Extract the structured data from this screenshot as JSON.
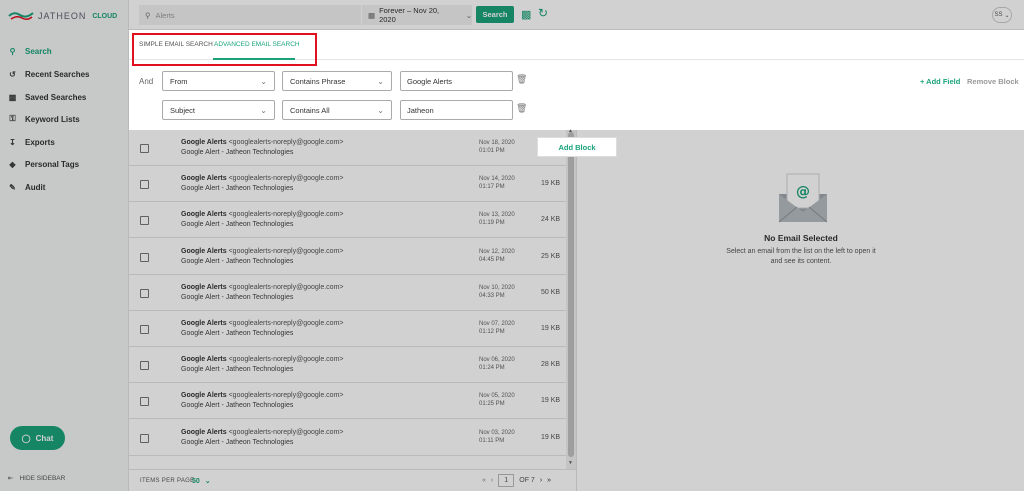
{
  "app": {
    "logo_text": "JATHEON",
    "logo_badge": "CLOUD"
  },
  "sidebar": {
    "items": [
      {
        "label": "Search",
        "icon": "search-icon"
      },
      {
        "label": "Recent Searches",
        "icon": "history-icon"
      },
      {
        "label": "Saved Searches",
        "icon": "save-icon"
      },
      {
        "label": "Keyword Lists",
        "icon": "key-icon"
      },
      {
        "label": "Exports",
        "icon": "export-icon"
      },
      {
        "label": "Personal Tags",
        "icon": "tag-icon"
      },
      {
        "label": "Audit",
        "icon": "audit-icon"
      }
    ],
    "chat_label": "Chat",
    "hide_label": "HIDE SIDEBAR"
  },
  "topbar": {
    "search_placeholder": "Alerts",
    "date_range": "Forever – Nov 20, 2020",
    "search_button": "Search",
    "user_initials": "SS"
  },
  "tabs": {
    "simple": "SIMPLE EMAIL SEARCH",
    "advanced": "ADVANCED EMAIL SEARCH",
    "active": "advanced"
  },
  "query": {
    "operator": "And",
    "rows": [
      {
        "field": "From",
        "condition": "Contains Phrase",
        "value": "Google Alerts"
      },
      {
        "field": "Subject",
        "condition": "Contains All",
        "value": "Jatheon"
      }
    ],
    "add_field": "+ Add Field",
    "remove_block": "Remove Block",
    "add_block": "Add Block"
  },
  "emails": [
    {
      "sender": "Google Alerts",
      "address": "<googlealerts-noreply@google.com>",
      "subject": "Google Alert - Jatheon Technologies",
      "date": "Nov 18, 2020",
      "time": "01:01 PM",
      "size": ""
    },
    {
      "sender": "Google Alerts",
      "address": "<googlealerts-noreply@google.com>",
      "subject": "Google Alert - Jatheon Technologies",
      "date": "Nov 14, 2020",
      "time": "01:17 PM",
      "size": "19 KB"
    },
    {
      "sender": "Google Alerts",
      "address": "<googlealerts-noreply@google.com>",
      "subject": "Google Alert - Jatheon Technologies",
      "date": "Nov 13, 2020",
      "time": "01:19 PM",
      "size": "24 KB"
    },
    {
      "sender": "Google Alerts",
      "address": "<googlealerts-noreply@google.com>",
      "subject": "Google Alert - Jatheon Technologies",
      "date": "Nov 12, 2020",
      "time": "04:45 PM",
      "size": "25 KB"
    },
    {
      "sender": "Google Alerts",
      "address": "<googlealerts-noreply@google.com>",
      "subject": "Google Alert - Jatheon Technologies",
      "date": "Nov 10, 2020",
      "time": "04:33 PM",
      "size": "50 KB"
    },
    {
      "sender": "Google Alerts",
      "address": "<googlealerts-noreply@google.com>",
      "subject": "Google Alert - Jatheon Technologies",
      "date": "Nov 07, 2020",
      "time": "01:12 PM",
      "size": "19 KB"
    },
    {
      "sender": "Google Alerts",
      "address": "<googlealerts-noreply@google.com>",
      "subject": "Google Alert - Jatheon Technologies",
      "date": "Nov 06, 2020",
      "time": "01:24 PM",
      "size": "28 KB"
    },
    {
      "sender": "Google Alerts",
      "address": "<googlealerts-noreply@google.com>",
      "subject": "Google Alert - Jatheon Technologies",
      "date": "Nov 05, 2020",
      "time": "01:25 PM",
      "size": "19 KB"
    },
    {
      "sender": "Google Alerts",
      "address": "<googlealerts-noreply@google.com>",
      "subject": "Google Alert - Jatheon Technologies",
      "date": "Nov 03, 2020",
      "time": "01:11 PM",
      "size": "19 KB"
    }
  ],
  "preview": {
    "title": "No Email Selected",
    "description": "Select an email from the list on the left to open it and see its content."
  },
  "footer": {
    "items_per_page_label": "ITEMS PER PAGE",
    "items_per_page_value": "50",
    "current_page": "1",
    "page_of": "OF 7"
  },
  "colors": {
    "accent": "#1aa37a",
    "highlight_box": "#e0101f"
  }
}
